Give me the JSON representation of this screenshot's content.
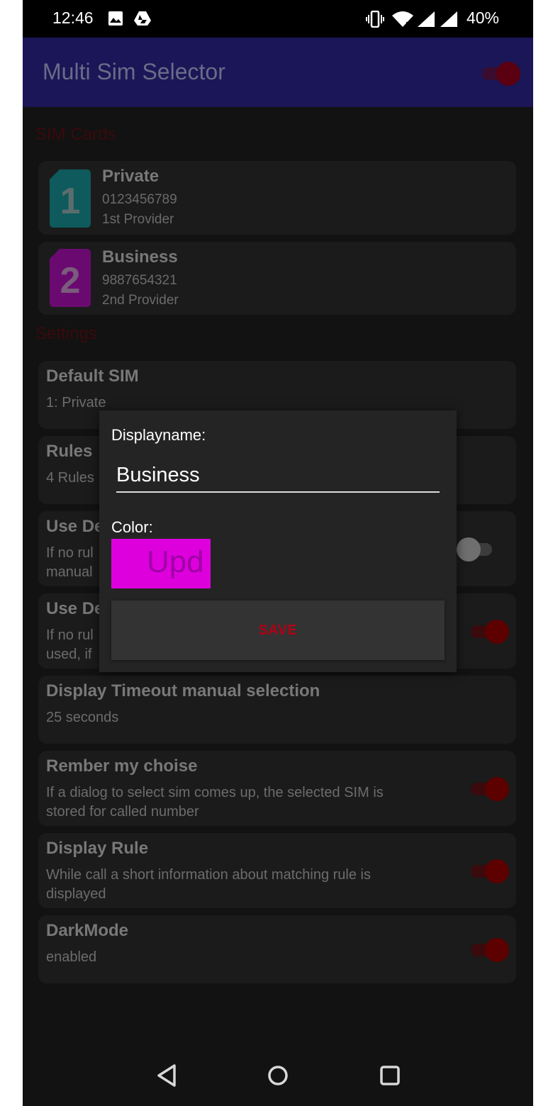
{
  "status_bar": {
    "time": "12:46",
    "battery": "40%",
    "icons": [
      "image-icon",
      "drive-icon",
      "vibrate-icon",
      "wifi-icon",
      "signal-icon",
      "signal-icon"
    ]
  },
  "app_bar": {
    "title": "Multi Sim Selector",
    "enabled": true
  },
  "sections": {
    "sim_cards": "SIM Cards",
    "settings": "Settings"
  },
  "sims": [
    {
      "slot": "1",
      "name": "Private",
      "number": "0123456789",
      "provider": "1st Provider",
      "color": "#0e5a5c"
    },
    {
      "slot": "2",
      "name": "Business",
      "number": "9887654321",
      "provider": "2nd Provider",
      "color": "#6a0a70"
    }
  ],
  "settings": {
    "default_sim": {
      "title": "Default SIM",
      "value": "1: Private"
    },
    "rules": {
      "title": "Rules",
      "value": "4 Rules"
    },
    "use_default_1": {
      "title": "Use De",
      "line1": "If no rul",
      "line2": "manual",
      "enabled": false
    },
    "use_default_2": {
      "title": "Use De",
      "line1": "If no rul",
      "line2": "used, if",
      "enabled": true
    },
    "display_timeout": {
      "title": "Display Timeout manual selection",
      "value": "25 seconds"
    },
    "remember": {
      "title": "Rember my choise",
      "line1": "If a dialog to select sim comes up, the selected SIM is",
      "line2": "stored for called number",
      "enabled": true
    },
    "display_rule": {
      "title": "Display Rule",
      "line1": "While call a short information about matching rule is",
      "line2": "displayed",
      "enabled": true
    },
    "dark_mode": {
      "title": "DarkMode",
      "value": "enabled",
      "enabled": true
    }
  },
  "dialog": {
    "name_label": "Displayname:",
    "name_value": "Business",
    "color_label": "Color:",
    "color_value": "#dd00dd",
    "swatch_text": "Upd",
    "save_label": "SAVE"
  },
  "colors": {
    "app_bar": "#1a1657",
    "accent": "#b00016",
    "background": "#121212"
  }
}
